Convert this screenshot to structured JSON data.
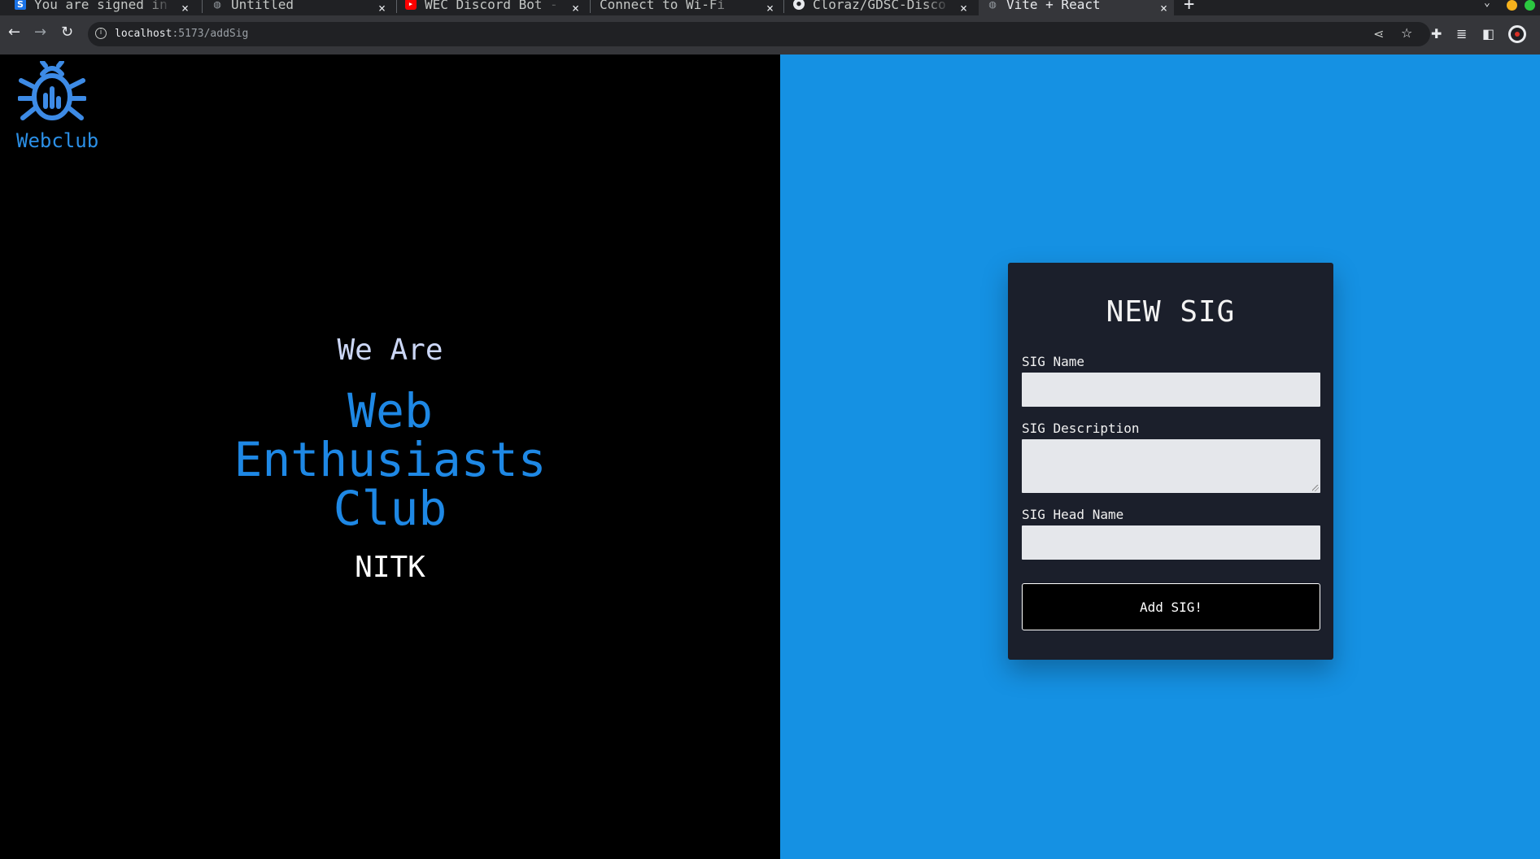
{
  "browser": {
    "tabs": [
      {
        "title": "You are signed in",
        "favicon": "s-icon"
      },
      {
        "title": "Untitled",
        "favicon": "globe-icon"
      },
      {
        "title": "WEC Discord Bot -",
        "favicon": "youtube-icon"
      },
      {
        "title": "Connect to Wi-Fi",
        "favicon": ""
      },
      {
        "title": "Cloraz/GDSC-Disco",
        "favicon": "github-icon"
      },
      {
        "title": "Vite + React",
        "favicon": "globe-icon"
      }
    ],
    "url_host": "localhost",
    "url_rest": ":5173/addSig"
  },
  "brand": {
    "logo_text": "Webclub",
    "accent": "#1e88e5",
    "logo_color": "#3d8be6"
  },
  "hero": {
    "we_are": "We Are",
    "line1": "Web",
    "line2": "Enthusiasts",
    "line3": "Club",
    "nitk": "NITK"
  },
  "form": {
    "title": "NEW SIG",
    "fields": [
      {
        "label": "SIG Name",
        "value": ""
      },
      {
        "label": "SIG Description",
        "value": ""
      },
      {
        "label": "SIG Head Name",
        "value": ""
      }
    ],
    "submit_label": "Add SIG!"
  },
  "colors": {
    "left_bg": "#000000",
    "right_bg": "#1591e3",
    "card_bg": "#1b1f2b",
    "input_bg": "#e5e7eb"
  }
}
